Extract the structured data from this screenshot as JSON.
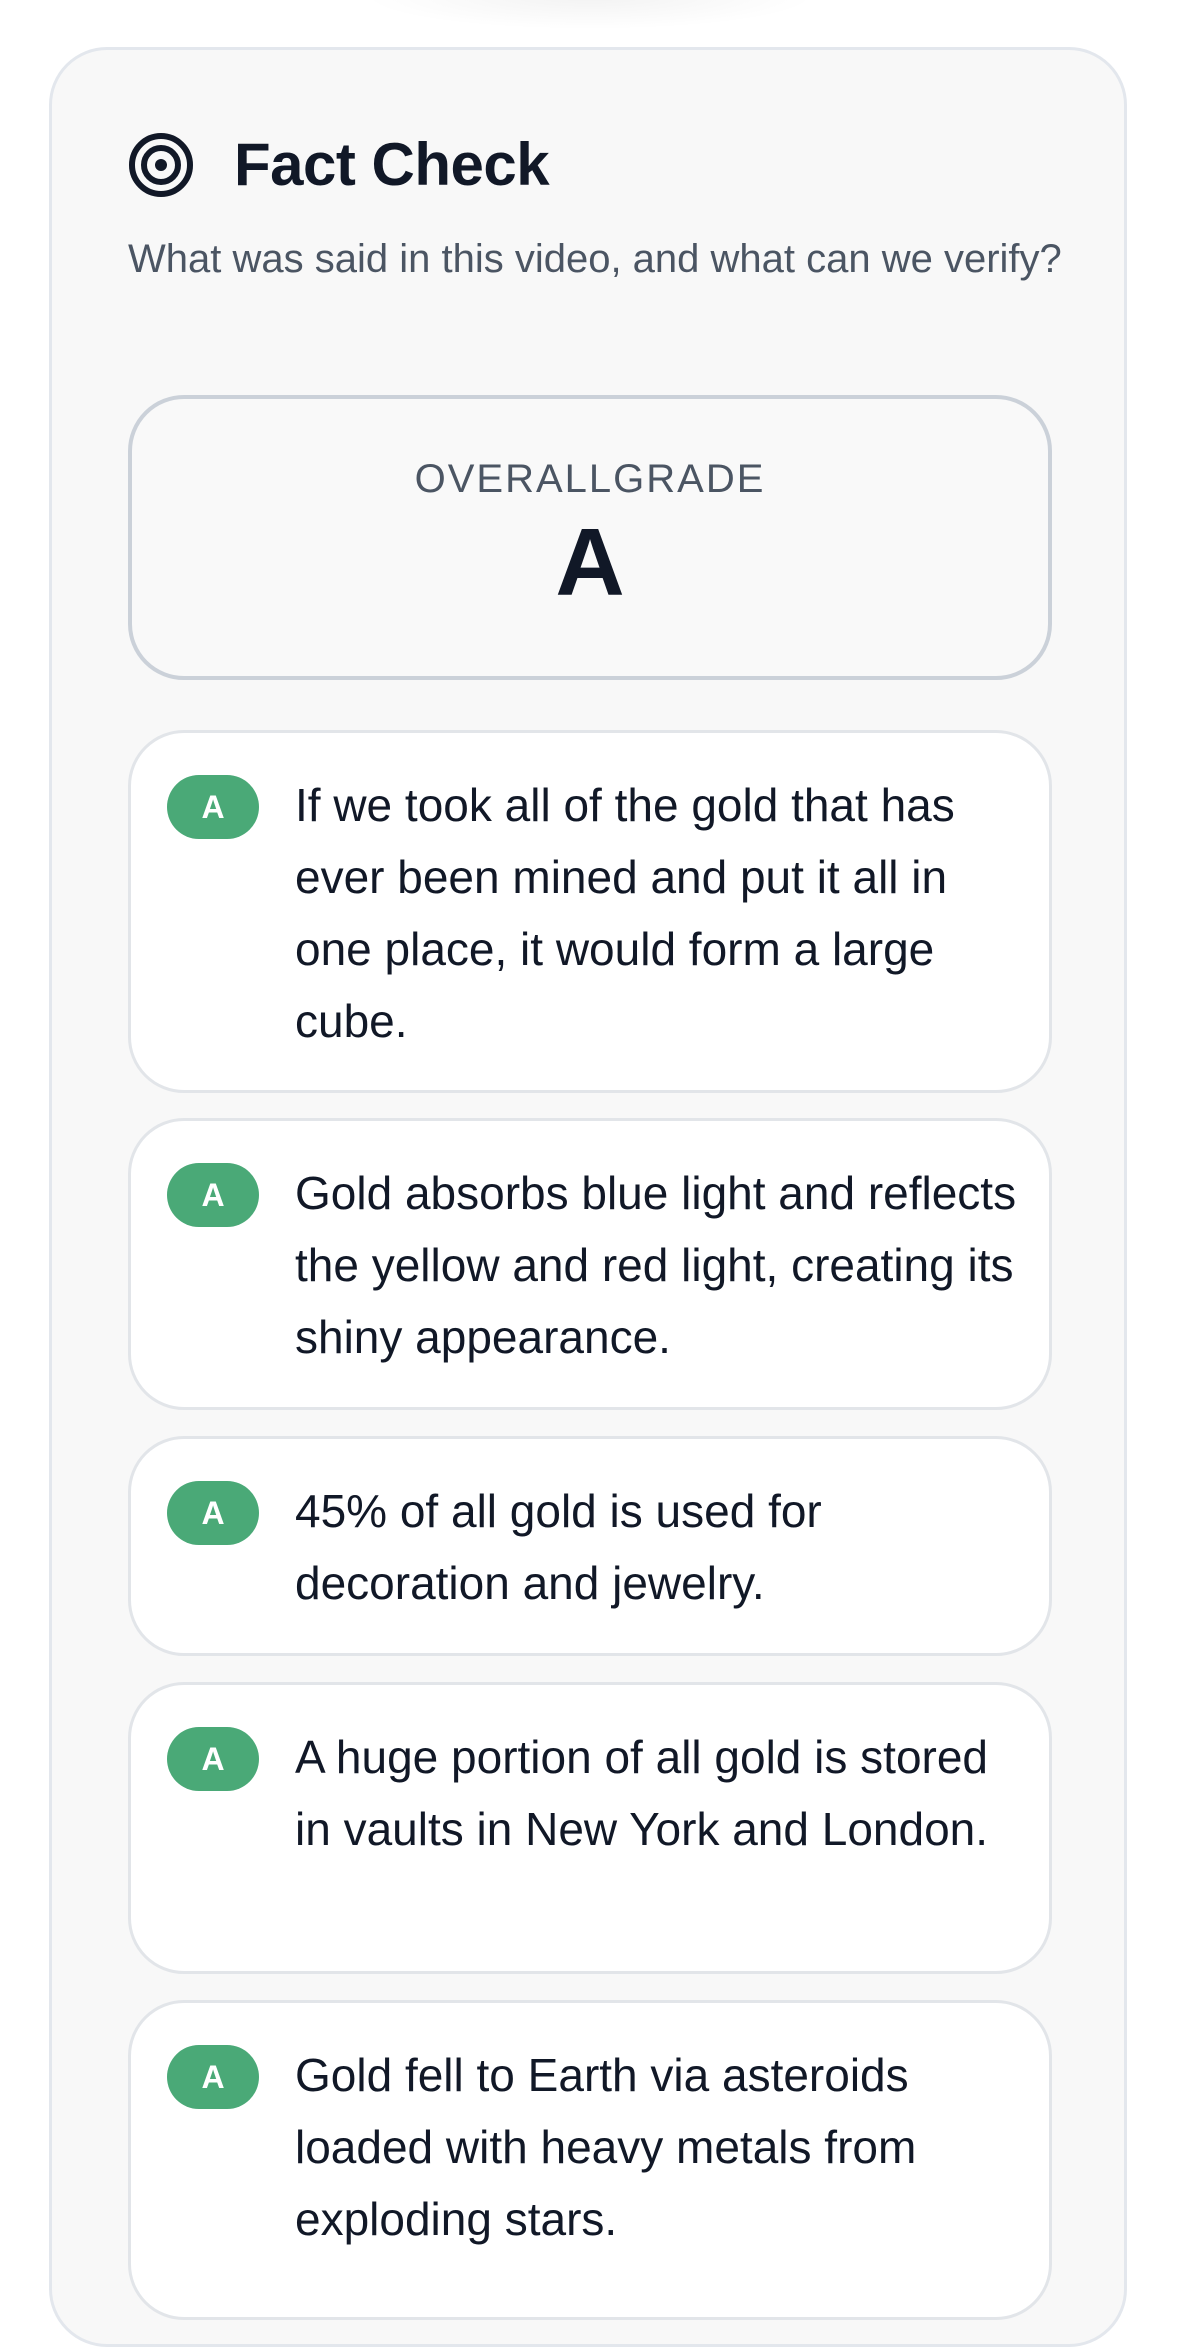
{
  "header": {
    "icon": "target-icon",
    "title": "Fact Check",
    "subtitle": "What was said in this video, and what can we verify?"
  },
  "overall": {
    "label": "OVERALLGRADE",
    "grade": "A"
  },
  "colors": {
    "badge": "#4aa977",
    "panel_bg": "#f8f8f8",
    "text": "#111827",
    "muted": "#4b5563"
  },
  "claims": [
    {
      "grade": "A",
      "text": "If we took all of the gold that has ever been mined and put it all in one place, it would form a large cube."
    },
    {
      "grade": "A",
      "text": "Gold absorbs blue light and reflects the yellow and red light, creating its shiny appearance."
    },
    {
      "grade": "A",
      "text": "45% of all gold is used for decoration and jewelry."
    },
    {
      "grade": "A",
      "text": "A huge portion of all gold is stored in vaults in New York and London."
    },
    {
      "grade": "A",
      "text": "Gold fell to Earth via asteroids loaded with heavy metals from exploding stars."
    }
  ]
}
